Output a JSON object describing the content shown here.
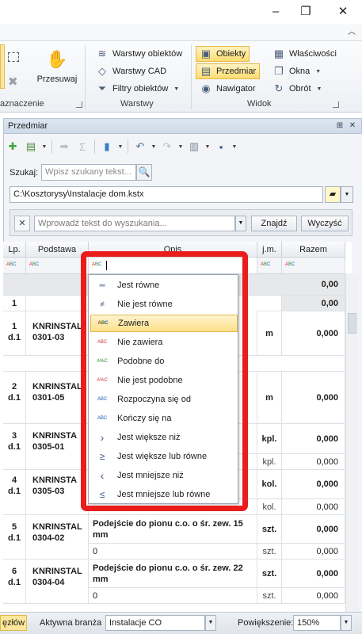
{
  "window": {
    "minimize_glyph": "–",
    "restore_glyph": "❐",
    "close_glyph": "✕",
    "collapse_glyph": "︿"
  },
  "ribbon": {
    "selection_group_label": "aznaczenie",
    "move_button": "Przesuwaj",
    "layers_group": {
      "label": "Warstwy",
      "items": [
        "Warstwy obiektów",
        "Warstwy CAD",
        "Filtry obiektów"
      ]
    },
    "view_group": {
      "label": "Widok",
      "items": [
        "Obiekty",
        "Przedmiar",
        "Nawigator"
      ]
    },
    "extra_group": {
      "items": [
        "Właściwości",
        "Okna",
        "Obrót"
      ]
    }
  },
  "pane": {
    "title": "Przedmiar",
    "pin_glyph": "⊞",
    "close_glyph": "✕",
    "search_label": "Szukaj:",
    "search_placeholder": "Wpisz szukany tekst...",
    "file_path": "C:\\Kosztorysy\\Instalacje dom.kstx",
    "filter_placeholder": "Wprowadź tekst do wyszukania...",
    "find_button": "Znajdź",
    "clear_button": "Wyczyść"
  },
  "grid": {
    "headers": [
      "Lp.",
      "Podstawa",
      "Opis",
      "j.m.",
      "Razem"
    ],
    "filter_token": "ABC",
    "rows": [
      {
        "lp": "",
        "base": "",
        "desc": "",
        "unit": "",
        "total": "0,00"
      },
      {
        "lp": "1",
        "base": "",
        "desc": "",
        "unit": "",
        "total": "0,00"
      },
      {
        "lp": "1\nd.1",
        "base": "KNRINSTAL\n0301-03",
        "desc": "",
        "unit": "m",
        "total": "0,000"
      },
      {
        "lp": "2\nd.1",
        "base": "KNRINSTAL\n0301-05",
        "desc": "",
        "unit": "m",
        "total": "0,000"
      },
      {
        "lp": "3\nd.1",
        "base": "KNRINSTA\n0305-01",
        "desc": "",
        "unit": "kpl.",
        "total": "0,000",
        "sub_unit": "kpl.",
        "sub_total": "0,000"
      },
      {
        "lp": "4\nd.1",
        "base": "KNRINSTA\n0305-03",
        "desc": "",
        "unit": "kol.",
        "total": "0,000",
        "sub_unit": "kol.",
        "sub_total": "0,000"
      },
      {
        "lp": "5\nd.1",
        "base": "KNRINSTAL\n0304-02",
        "desc": "Podejście do pionu c.o. o śr. zew. 15 mm",
        "unit": "szt.",
        "total": "0,000",
        "sub_desc": "0",
        "sub_unit": "szt.",
        "sub_total": "0,000"
      },
      {
        "lp": "6\nd.1",
        "base": "KNRINSTAL\n0304-04",
        "desc": "Podejście do pionu c.o. o śr. zew. 22 mm",
        "unit": "szt.",
        "total": "0,000",
        "sub_desc": "0",
        "sub_unit": "szt.",
        "sub_total": "0,000"
      }
    ]
  },
  "filter_menu": {
    "items": [
      {
        "icon": "equals-icon",
        "glyph": "═",
        "label": "Jest równe"
      },
      {
        "icon": "not-equals-icon",
        "glyph": "≠",
        "label": "Nie jest równe"
      },
      {
        "icon": "contains-icon",
        "glyph": "ABC",
        "label": "Zawiera",
        "selected": true
      },
      {
        "icon": "not-contains-icon",
        "glyph": "ABC",
        "label": "Nie zawiera"
      },
      {
        "icon": "like-icon",
        "glyph": "A%C",
        "label": "Podobne do"
      },
      {
        "icon": "not-like-icon",
        "glyph": "A%C",
        "label": "Nie jest podobne"
      },
      {
        "icon": "starts-with-icon",
        "glyph": "ABC",
        "label": "Rozpoczyna się od"
      },
      {
        "icon": "ends-with-icon",
        "glyph": "ABC",
        "label": "Kończy się na"
      },
      {
        "icon": "greater-icon",
        "glyph": "›",
        "label": "Jest większe niż"
      },
      {
        "icon": "greater-equal-icon",
        "glyph": "≥",
        "label": "Jest większe lub równe"
      },
      {
        "icon": "less-icon",
        "glyph": "‹",
        "label": "Jest mniejsze niż"
      },
      {
        "icon": "less-equal-icon",
        "glyph": "≤",
        "label": "Jest mniejsze lub równe"
      }
    ]
  },
  "statusbar": {
    "tab_label": "ęzłów",
    "branch_label": "Aktywna branża",
    "branch_value": "Instalacje CO",
    "zoom_label": "Powiększenie:",
    "zoom_value": "150%"
  },
  "colors": {
    "highlight": "#ea1c1c",
    "selected_item": "#fde08a",
    "ribbon_active": "#fddc71"
  }
}
